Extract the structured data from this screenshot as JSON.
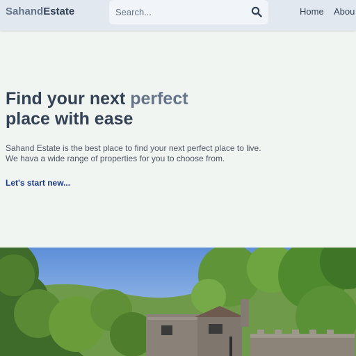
{
  "header": {
    "logo_part1": "Sahand",
    "logo_part2": "Estate",
    "search_placeholder": "Search...",
    "nav": [
      {
        "label": "Home"
      },
      {
        "label": "Abou"
      }
    ]
  },
  "hero": {
    "headline_part1": "Find your next ",
    "headline_accent": "perfect",
    "headline_part2": "place with ease",
    "description_line1": "Sahand Estate is the best place to find your next perfect place to live.",
    "description_line2": "We hava a wide range of properties for you to choose from.",
    "cta_label": "Let's start new..."
  },
  "colors": {
    "header_bg": "#e2e8f0",
    "page_bg": "#f1f5f1",
    "text_dark": "#334155",
    "text_muted": "#64748b",
    "link": "#1e3a8a"
  }
}
